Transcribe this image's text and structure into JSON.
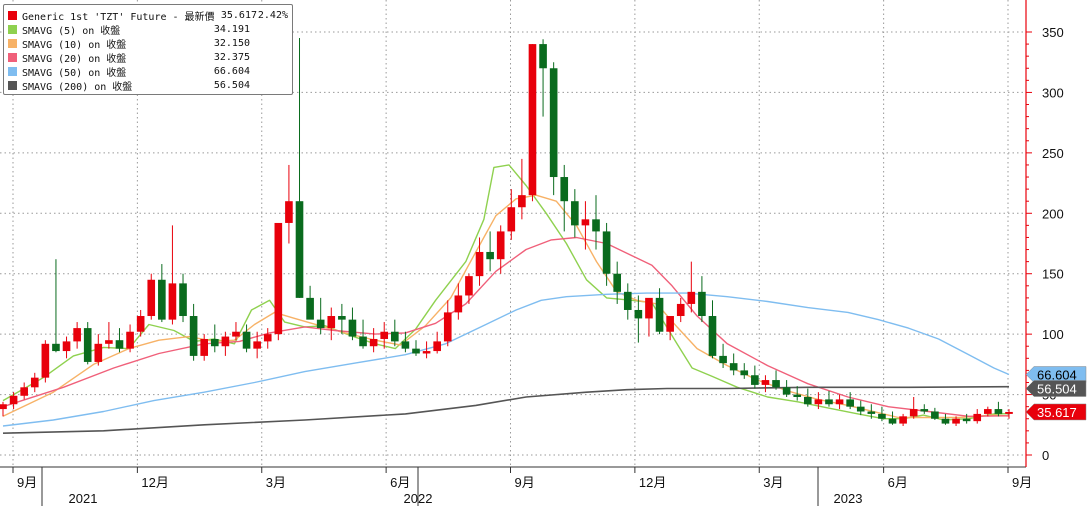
{
  "chart_data": {
    "type": "candlestick",
    "y_ticks": [
      0,
      50,
      100,
      150,
      200,
      250,
      300,
      350
    ],
    "ylim": [
      -10,
      375
    ],
    "x_ticks": [
      {
        "label": "9月",
        "date": "2020-09"
      },
      {
        "label": "12月",
        "date": "2020-12"
      },
      {
        "label": "3月",
        "date": "2021-03"
      },
      {
        "label": "6月",
        "date": "2021-06"
      },
      {
        "label": "9月",
        "date": "2021-09"
      },
      {
        "label": "12月",
        "date": "2021-12"
      },
      {
        "label": "3月",
        "date": "2022-03"
      },
      {
        "label": "6月",
        "date": "2022-06"
      },
      {
        "label": "9月",
        "date": "2022-09"
      }
    ],
    "year_labels": [
      "2021",
      "2022",
      "2023"
    ],
    "legend": {
      "main": {
        "name": "Generic 1st 'TZT' Future - 最新價",
        "value": "35.617",
        "change": "2.42%",
        "color": "#e8000b"
      },
      "items": [
        {
          "name": "SMAVG (5)  on 收盤",
          "value": "34.191",
          "color": "#8fd14f"
        },
        {
          "name": "SMAVG (10)  on 收盤",
          "value": "32.150",
          "color": "#f7b267"
        },
        {
          "name": "SMAVG (20)  on 收盤",
          "value": "32.375",
          "color": "#f0607a"
        },
        {
          "name": "SMAVG (50)  on 收盤",
          "value": "66.604",
          "color": "#7fbdf0"
        },
        {
          "name": "SMAVG (200)  on 收盤",
          "value": "56.504",
          "color": "#555555"
        }
      ]
    },
    "last_value_labels": [
      {
        "text": "66.604",
        "value": 66.604,
        "bg": "#7fbdf0",
        "fg": "#000000"
      },
      {
        "text": "56.504",
        "value": 56.504,
        "bg": "#555555",
        "fg": "#ffffff"
      },
      {
        "text": "35.617",
        "value": 35.617,
        "bg": "#e8000b",
        "fg": "#ffffff"
      }
    ],
    "candles": [
      [
        38,
        44,
        32,
        42
      ],
      [
        42,
        52,
        38,
        49
      ],
      [
        49,
        60,
        46,
        56
      ],
      [
        56,
        68,
        52,
        64
      ],
      [
        64,
        95,
        60,
        92
      ],
      [
        92,
        162,
        85,
        86
      ],
      [
        86,
        98,
        80,
        94
      ],
      [
        94,
        110,
        88,
        105
      ],
      [
        105,
        110,
        75,
        77
      ],
      [
        77,
        100,
        74,
        92
      ],
      [
        92,
        110,
        88,
        95
      ],
      [
        95,
        105,
        85,
        88
      ],
      [
        88,
        108,
        85,
        102
      ],
      [
        102,
        120,
        98,
        115
      ],
      [
        115,
        150,
        112,
        145
      ],
      [
        145,
        158,
        110,
        112
      ],
      [
        112,
        190,
        108,
        142
      ],
      [
        142,
        150,
        110,
        115
      ],
      [
        115,
        125,
        78,
        82
      ],
      [
        82,
        100,
        78,
        96
      ],
      [
        96,
        108,
        85,
        90
      ],
      [
        90,
        102,
        82,
        98
      ],
      [
        98,
        110,
        95,
        102
      ],
      [
        102,
        108,
        85,
        88
      ],
      [
        88,
        102,
        80,
        94
      ],
      [
        94,
        105,
        88,
        100
      ],
      [
        100,
        175,
        95,
        192
      ],
      [
        192,
        240,
        175,
        210
      ],
      [
        210,
        345,
        130,
        130
      ],
      [
        130,
        140,
        115,
        112
      ],
      [
        112,
        130,
        100,
        105
      ],
      [
        105,
        122,
        95,
        115
      ],
      [
        115,
        125,
        100,
        112
      ],
      [
        112,
        122,
        95,
        98
      ],
      [
        98,
        112,
        88,
        90
      ],
      [
        90,
        105,
        85,
        96
      ],
      [
        96,
        110,
        88,
        102
      ],
      [
        102,
        112,
        90,
        94
      ],
      [
        94,
        102,
        85,
        88
      ],
      [
        88,
        95,
        82,
        84
      ],
      [
        84,
        94,
        80,
        86
      ],
      [
        86,
        102,
        84,
        94
      ],
      [
        94,
        128,
        90,
        118
      ],
      [
        118,
        142,
        112,
        132
      ],
      [
        132,
        150,
        125,
        148
      ],
      [
        148,
        180,
        140,
        168
      ],
      [
        168,
        185,
        152,
        162
      ],
      [
        162,
        190,
        150,
        185
      ],
      [
        185,
        220,
        178,
        205
      ],
      [
        205,
        245,
        195,
        215
      ],
      [
        215,
        340,
        210,
        340
      ],
      [
        340,
        344,
        280,
        320
      ],
      [
        320,
        325,
        215,
        230
      ],
      [
        230,
        240,
        185,
        210
      ],
      [
        210,
        220,
        180,
        190
      ],
      [
        190,
        210,
        170,
        195
      ],
      [
        195,
        215,
        170,
        185
      ],
      [
        185,
        192,
        140,
        150
      ],
      [
        150,
        160,
        125,
        135
      ],
      [
        135,
        142,
        112,
        120
      ],
      [
        120,
        132,
        93,
        113
      ],
      [
        113,
        122,
        98,
        130
      ],
      [
        130,
        138,
        100,
        102
      ],
      [
        102,
        112,
        95,
        115
      ],
      [
        115,
        130,
        110,
        125
      ],
      [
        125,
        160,
        118,
        135
      ],
      [
        135,
        148,
        110,
        115
      ],
      [
        115,
        128,
        80,
        82
      ],
      [
        82,
        92,
        72,
        76
      ],
      [
        76,
        84,
        66,
        70
      ],
      [
        70,
        76,
        63,
        66
      ],
      [
        66,
        74,
        55,
        58
      ],
      [
        58,
        66,
        52,
        62
      ],
      [
        62,
        70,
        54,
        56
      ],
      [
        56,
        62,
        48,
        50
      ],
      [
        50,
        57,
        45,
        48
      ],
      [
        48,
        55,
        40,
        42
      ],
      [
        42,
        52,
        38,
        46
      ],
      [
        46,
        53,
        40,
        42
      ],
      [
        42,
        50,
        38,
        46
      ],
      [
        46,
        52,
        38,
        40
      ],
      [
        40,
        45,
        33,
        36
      ],
      [
        36,
        42,
        30,
        34
      ],
      [
        34,
        40,
        28,
        30
      ],
      [
        30,
        36,
        25,
        26
      ],
      [
        26,
        34,
        24,
        32
      ],
      [
        32,
        48,
        30,
        38
      ],
      [
        38,
        42,
        34,
        36
      ],
      [
        36,
        39,
        29,
        30
      ],
      [
        30,
        34,
        25,
        26
      ],
      [
        26,
        32,
        24,
        30
      ],
      [
        30,
        34,
        26,
        28
      ],
      [
        28,
        38,
        26,
        34
      ],
      [
        34,
        40,
        32,
        38
      ],
      [
        38,
        44,
        32,
        34
      ],
      [
        34,
        38,
        30,
        35.617
      ]
    ],
    "series": [
      {
        "name": "SMAVG (5)",
        "color": "#8fd14f",
        "width": 1.4,
        "points": [
          [
            0.0,
            45
          ],
          [
            0.04,
            64
          ],
          [
            0.07,
            82
          ],
          [
            0.1,
            89
          ],
          [
            0.125,
            88
          ],
          [
            0.145,
            108
          ],
          [
            0.17,
            103
          ],
          [
            0.19,
            94
          ],
          [
            0.21,
            96
          ],
          [
            0.23,
            92
          ],
          [
            0.247,
            120
          ],
          [
            0.265,
            128
          ],
          [
            0.28,
            110
          ],
          [
            0.3,
            106
          ],
          [
            0.32,
            107
          ],
          [
            0.345,
            99
          ],
          [
            0.37,
            92
          ],
          [
            0.39,
            88
          ],
          [
            0.41,
            104
          ],
          [
            0.43,
            128
          ],
          [
            0.46,
            160
          ],
          [
            0.478,
            195
          ],
          [
            0.488,
            238
          ],
          [
            0.503,
            240
          ],
          [
            0.52,
            223
          ],
          [
            0.54,
            200
          ],
          [
            0.56,
            175
          ],
          [
            0.58,
            145
          ],
          [
            0.6,
            130
          ],
          [
            0.625,
            128
          ],
          [
            0.645,
            126
          ],
          [
            0.67,
            92
          ],
          [
            0.685,
            72
          ],
          [
            0.705,
            65
          ],
          [
            0.73,
            56
          ],
          [
            0.76,
            48
          ],
          [
            0.79,
            44
          ],
          [
            0.82,
            39
          ],
          [
            0.85,
            34
          ],
          [
            0.875,
            30
          ],
          [
            0.895,
            30
          ],
          [
            0.915,
            33
          ],
          [
            0.935,
            29
          ],
          [
            0.96,
            30
          ],
          [
            0.985,
            34
          ],
          [
            1.0,
            34.2
          ]
        ]
      },
      {
        "name": "SMAVG (10)",
        "color": "#f7b267",
        "width": 1.4,
        "points": [
          [
            0.0,
            32
          ],
          [
            0.05,
            52
          ],
          [
            0.09,
            75
          ],
          [
            0.125,
            88
          ],
          [
            0.155,
            95
          ],
          [
            0.185,
            98
          ],
          [
            0.21,
            94
          ],
          [
            0.23,
            95
          ],
          [
            0.25,
            108
          ],
          [
            0.27,
            118
          ],
          [
            0.29,
            113
          ],
          [
            0.315,
            107
          ],
          [
            0.34,
            101
          ],
          [
            0.37,
            95
          ],
          [
            0.395,
            91
          ],
          [
            0.42,
            107
          ],
          [
            0.445,
            130
          ],
          [
            0.47,
            168
          ],
          [
            0.49,
            198
          ],
          [
            0.51,
            212
          ],
          [
            0.53,
            215
          ],
          [
            0.55,
            210
          ],
          [
            0.57,
            190
          ],
          [
            0.59,
            160
          ],
          [
            0.61,
            135
          ],
          [
            0.63,
            128
          ],
          [
            0.65,
            125
          ],
          [
            0.67,
            106
          ],
          [
            0.69,
            88
          ],
          [
            0.72,
            74
          ],
          [
            0.75,
            62
          ],
          [
            0.78,
            53
          ],
          [
            0.81,
            46
          ],
          [
            0.84,
            41
          ],
          [
            0.87,
            35
          ],
          [
            0.89,
            31
          ],
          [
            0.92,
            31
          ],
          [
            0.95,
            31
          ],
          [
            0.985,
            33
          ],
          [
            1.0,
            32.2
          ]
        ]
      },
      {
        "name": "SMAVG (20)",
        "color": "#f0607a",
        "width": 1.4,
        "points": [
          [
            0.0,
            40
          ],
          [
            0.06,
            56
          ],
          [
            0.11,
            72
          ],
          [
            0.155,
            84
          ],
          [
            0.2,
            92
          ],
          [
            0.235,
            94
          ],
          [
            0.265,
            101
          ],
          [
            0.3,
            106
          ],
          [
            0.33,
            103
          ],
          [
            0.37,
            100
          ],
          [
            0.4,
            101
          ],
          [
            0.43,
            109
          ],
          [
            0.46,
            125
          ],
          [
            0.49,
            152
          ],
          [
            0.52,
            170
          ],
          [
            0.545,
            178
          ],
          [
            0.57,
            180
          ],
          [
            0.6,
            175
          ],
          [
            0.625,
            165
          ],
          [
            0.645,
            157
          ],
          [
            0.665,
            140
          ],
          [
            0.69,
            115
          ],
          [
            0.72,
            92
          ],
          [
            0.76,
            74
          ],
          [
            0.8,
            59
          ],
          [
            0.84,
            48
          ],
          [
            0.88,
            40
          ],
          [
            0.92,
            36
          ],
          [
            0.96,
            32
          ],
          [
            1.0,
            32.4
          ]
        ]
      },
      {
        "name": "SMAVG (50)",
        "color": "#7fbdf0",
        "width": 1.4,
        "points": [
          [
            0.0,
            24
          ],
          [
            0.05,
            29
          ],
          [
            0.1,
            36
          ],
          [
            0.15,
            45
          ],
          [
            0.2,
            52
          ],
          [
            0.25,
            60
          ],
          [
            0.3,
            69
          ],
          [
            0.35,
            76
          ],
          [
            0.4,
            83
          ],
          [
            0.44,
            92
          ],
          [
            0.48,
            108
          ],
          [
            0.51,
            120
          ],
          [
            0.535,
            128
          ],
          [
            0.56,
            131
          ],
          [
            0.6,
            133
          ],
          [
            0.64,
            134
          ],
          [
            0.68,
            134
          ],
          [
            0.72,
            131
          ],
          [
            0.76,
            127
          ],
          [
            0.8,
            122
          ],
          [
            0.84,
            118
          ],
          [
            0.87,
            112
          ],
          [
            0.9,
            105
          ],
          [
            0.93,
            96
          ],
          [
            0.96,
            83
          ],
          [
            0.985,
            72
          ],
          [
            1.0,
            66.6
          ]
        ]
      },
      {
        "name": "SMAVG (200)",
        "color": "#555555",
        "width": 1.6,
        "points": [
          [
            0.0,
            18
          ],
          [
            0.1,
            20
          ],
          [
            0.2,
            25
          ],
          [
            0.3,
            29
          ],
          [
            0.4,
            34
          ],
          [
            0.47,
            41
          ],
          [
            0.52,
            48
          ],
          [
            0.58,
            52
          ],
          [
            0.62,
            54
          ],
          [
            0.66,
            55
          ],
          [
            0.72,
            55
          ],
          [
            0.8,
            56
          ],
          [
            0.9,
            56
          ],
          [
            1.0,
            56.5
          ]
        ]
      }
    ]
  }
}
